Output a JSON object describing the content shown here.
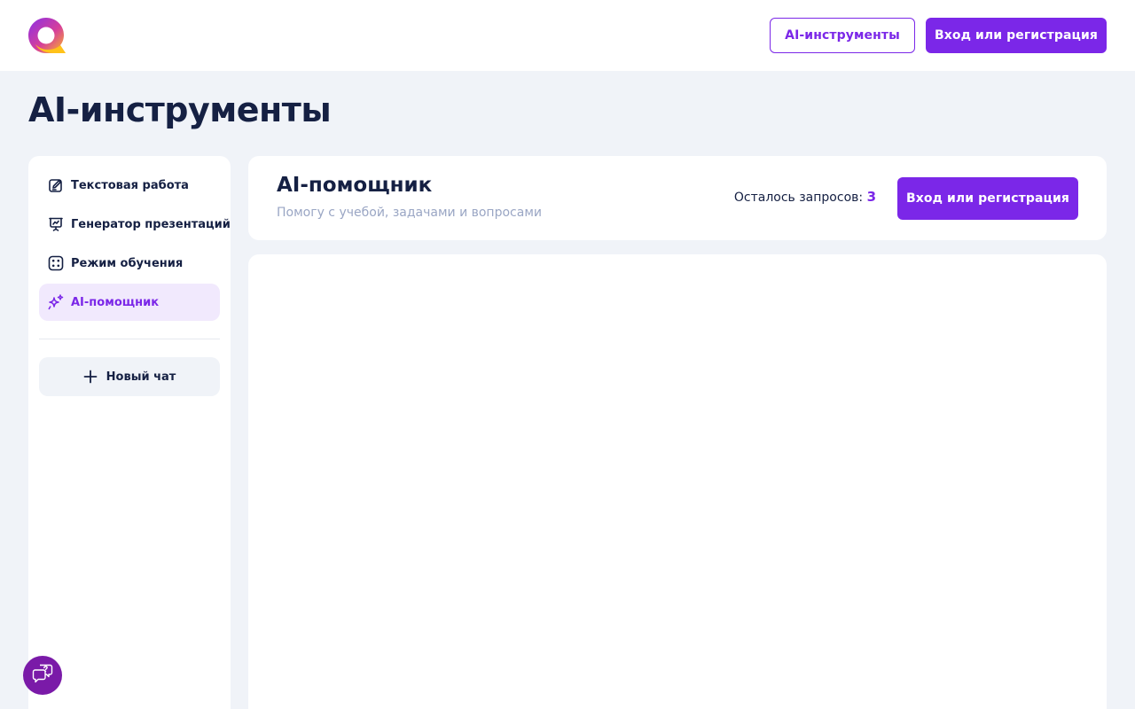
{
  "header": {
    "logo_icon": "brand-logo-icon",
    "tools_button_label": "AI-инструменты",
    "login_button_label": "Вход или регистрация"
  },
  "page": {
    "title": "AI-инструменты"
  },
  "sidebar": {
    "items": [
      {
        "label": "Текстовая работа",
        "icon": "edit-document-icon",
        "active": false
      },
      {
        "label": "Генератор презентаций",
        "icon": "presentation-icon",
        "active": false
      },
      {
        "label": "Режим обучения",
        "icon": "dice-grid-icon",
        "active": false
      },
      {
        "label": "AI-помощник",
        "icon": "sparkles-icon",
        "active": true
      }
    ],
    "new_chat_label": "Новый чат"
  },
  "assistant": {
    "title": "AI-помощник",
    "subtitle": "Помогу с учебой, задачами и вопросами",
    "requests_label": "Осталось запросов:",
    "requests_count": "3",
    "login_button_label": "Вход или регистрация"
  },
  "help": {
    "icon": "chat-help-icon"
  },
  "colors": {
    "accent": "#7b27e8",
    "background": "#f0f3f8",
    "text": "#152043",
    "muted": "#9aa6c4",
    "active_bg": "#f1e9fd",
    "help_button": "#7a1aa8"
  }
}
